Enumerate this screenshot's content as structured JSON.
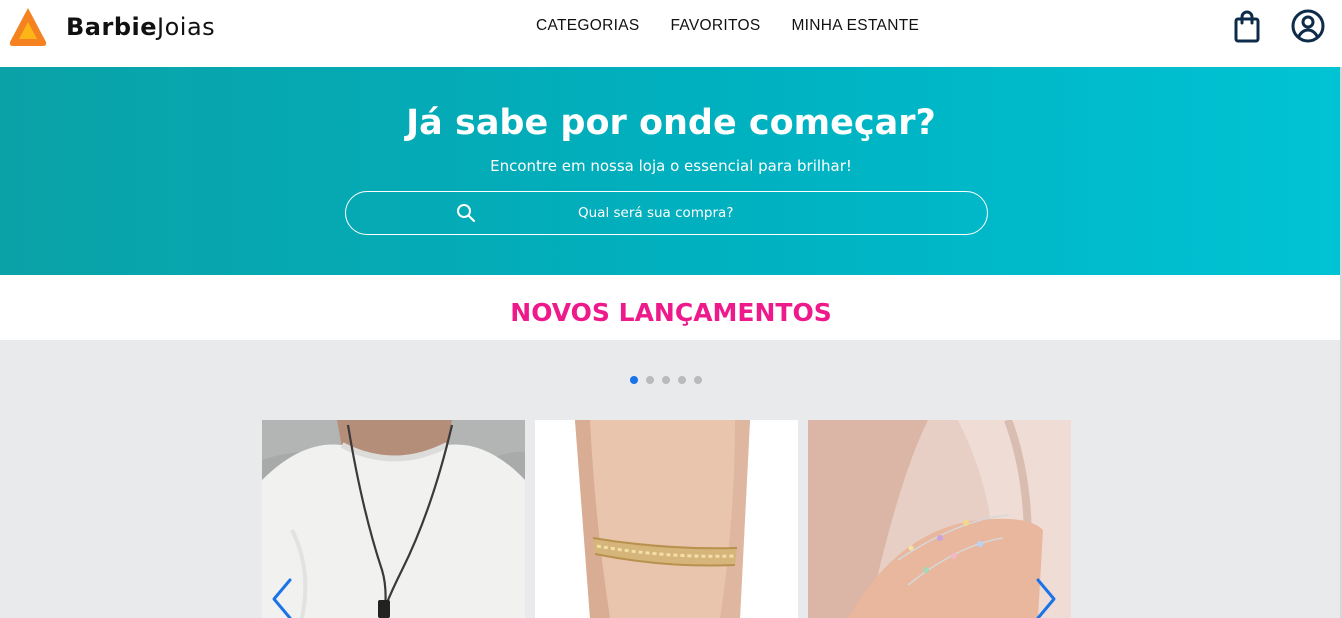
{
  "brand": {
    "name_bold": "Barbie",
    "name_light": "Joias",
    "icon": "triangle-logo-icon",
    "accent": "#f58220"
  },
  "nav": {
    "items": [
      "CATEGORIAS",
      "FAVORITOS",
      "MINHA ESTANTE"
    ]
  },
  "header_icons": {
    "bag": "shopping-bag-icon",
    "user": "user-circle-icon",
    "color": "#0e2c4a"
  },
  "hero": {
    "title": "Já sabe por onde começar?",
    "subtitle": "Encontre em nossa loja o essencial para brilhar!",
    "search_placeholder": "Qual será sua compra?",
    "gradient": [
      "#0aa2a7",
      "#00c3d4"
    ]
  },
  "section": {
    "title": "NOVOS LANÇAMENTOS",
    "color": "#ee1a8b"
  },
  "carousel": {
    "dots": 5,
    "active_dot": 1,
    "active_color": "#1a73e8",
    "cards": [
      "necklace-photo",
      "bracelet-photo",
      "charm-bracelet-photo"
    ],
    "arrows": {
      "prev": "chevron-left-icon",
      "next": "chevron-right-icon",
      "color": "#1a73e8"
    }
  }
}
